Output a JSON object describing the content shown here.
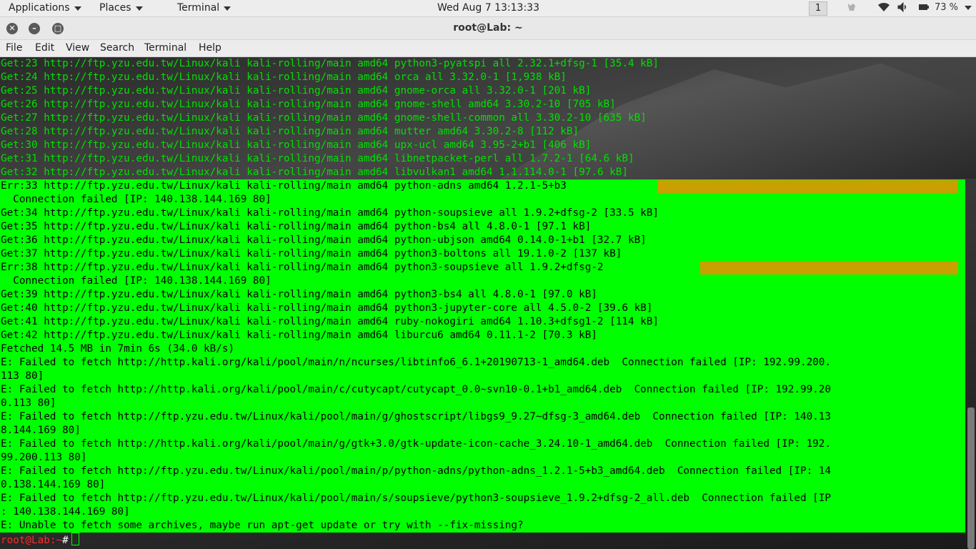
{
  "panel": {
    "applications": "Applications",
    "places": "Places",
    "terminal": "Terminal",
    "clock": "Wed Aug 7  13:13:33",
    "workspace": "1",
    "battery": "73 %"
  },
  "window": {
    "title": "root@Lab: ~",
    "menu": [
      "File",
      "Edit",
      "View",
      "Search",
      "Terminal",
      "Help"
    ]
  },
  "terminal": {
    "lines_normal": [
      "Get:23 http://ftp.yzu.edu.tw/Linux/kali kali-rolling/main amd64 python3-pyatspi all 2.32.1+dfsg-1 [35.4 kB]",
      "Get:24 http://ftp.yzu.edu.tw/Linux/kali kali-rolling/main amd64 orca all 3.32.0-1 [1,938 kB]",
      "Get:25 http://ftp.yzu.edu.tw/Linux/kali kali-rolling/main amd64 gnome-orca all 3.32.0-1 [201 kB]",
      "Get:26 http://ftp.yzu.edu.tw/Linux/kali kali-rolling/main amd64 gnome-shell amd64 3.30.2-10 [705 kB]",
      "Get:27 http://ftp.yzu.edu.tw/Linux/kali kali-rolling/main amd64 gnome-shell-common all 3.30.2-10 [635 kB]",
      "Get:28 http://ftp.yzu.edu.tw/Linux/kali kali-rolling/main amd64 mutter amd64 3.30.2-8 [112 kB]",
      "Get:30 http://ftp.yzu.edu.tw/Linux/kali kali-rolling/main amd64 upx-ucl amd64 3.95-2+b1 [406 kB]",
      "Get:31 http://ftp.yzu.edu.tw/Linux/kali kali-rolling/main amd64 libnetpacket-perl all 1.7.2-1 [64.6 kB]",
      "Get:32 http://ftp.yzu.edu.tw/Linux/kali kali-rolling/main amd64 libvulkan1 amd64 1.1.114.0-1 [97.6 kB]"
    ],
    "lines_highlighted": [
      "Err:33 http://ftp.yzu.edu.tw/Linux/kali kali-rolling/main amd64 python-adns amd64 1.2.1-5+b3",
      "  Connection failed [IP: 140.138.144.169 80]",
      "Get:34 http://ftp.yzu.edu.tw/Linux/kali kali-rolling/main amd64 python-soupsieve all 1.9.2+dfsg-2 [33.5 kB]",
      "Get:35 http://ftp.yzu.edu.tw/Linux/kali kali-rolling/main amd64 python-bs4 all 4.8.0-1 [97.1 kB]",
      "Get:36 http://ftp.yzu.edu.tw/Linux/kali kali-rolling/main amd64 python-ubjson amd64 0.14.0-1+b1 [32.7 kB]",
      "Get:37 http://ftp.yzu.edu.tw/Linux/kali kali-rolling/main amd64 python3-boltons all 19.1.0-2 [137 kB]",
      "Err:38 http://ftp.yzu.edu.tw/Linux/kali kali-rolling/main amd64 python3-soupsieve all 1.9.2+dfsg-2",
      "  Connection failed [IP: 140.138.144.169 80]",
      "Get:39 http://ftp.yzu.edu.tw/Linux/kali kali-rolling/main amd64 python3-bs4 all 4.8.0-1 [97.0 kB]",
      "Get:40 http://ftp.yzu.edu.tw/Linux/kali kali-rolling/main amd64 python3-jupyter-core all 4.5.0-2 [39.6 kB]",
      "Get:41 http://ftp.yzu.edu.tw/Linux/kali kali-rolling/main amd64 ruby-nokogiri amd64 1.10.3+dfsg1-2 [114 kB]",
      "Get:42 http://ftp.yzu.edu.tw/Linux/kali kali-rolling/main amd64 liburcu6 amd64 0.11.1-2 [70.3 kB]",
      "Fetched 14.5 MB in 7min 6s (34.0 kB/s)",
      "E: Failed to fetch http://http.kali.org/kali/pool/main/n/ncurses/libtinfo6_6.1+20190713-1_amd64.deb  Connection failed [IP: 192.99.200.",
      "113 80]",
      "E: Failed to fetch http://http.kali.org/kali/pool/main/c/cutycapt/cutycapt_0.0~svn10-0.1+b1_amd64.deb  Connection failed [IP: 192.99.20",
      "0.113 80]",
      "E: Failed to fetch http://ftp.yzu.edu.tw/Linux/kali/pool/main/g/ghostscript/libgs9_9.27~dfsg-3_amd64.deb  Connection failed [IP: 140.13",
      "8.144.169 80]",
      "E: Failed to fetch http://http.kali.org/kali/pool/main/g/gtk+3.0/gtk-update-icon-cache_3.24.10-1_amd64.deb  Connection failed [IP: 192.",
      "99.200.113 80]",
      "E: Failed to fetch http://ftp.yzu.edu.tw/Linux/kali/pool/main/p/python-adns/python-adns_1.2.1-5+b3_amd64.deb  Connection failed [IP: 14",
      "0.138.144.169 80]",
      "E: Failed to fetch http://ftp.yzu.edu.tw/Linux/kali/pool/main/s/soupsieve/python3-soupsieve_1.9.2+dfsg-2_all.deb  Connection failed [IP",
      ": 140.138.144.169 80]",
      "E: Unable to fetch some archives, maybe run apt-get update or try with --fix-missing?"
    ],
    "prompt_user": "root@Lab",
    "prompt_path": ":~",
    "prompt_symbol": "#"
  },
  "colors": {
    "highlight": "#00ff00",
    "progress_bar": "#c8a000",
    "prompt": "#ff2a2a"
  }
}
